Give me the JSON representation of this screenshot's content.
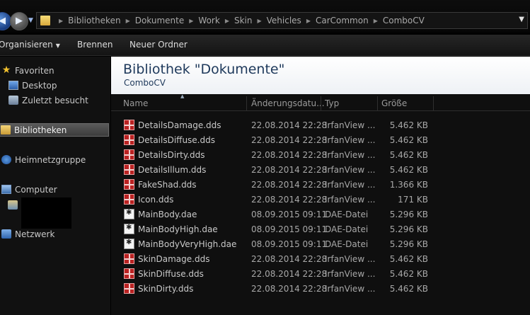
{
  "address": {
    "crumbs": [
      "Bibliotheken",
      "Dokumente",
      "Work",
      "Skin",
      "Vehicles",
      "CarCommon",
      "ComboCV"
    ]
  },
  "toolbar": {
    "organize": "Organisieren",
    "burn": "Brennen",
    "new_folder": "Neuer Ordner"
  },
  "nav": {
    "favorites": "Favoriten",
    "desktop": "Desktop",
    "recent": "Zuletzt besucht",
    "libraries": "Bibliotheken",
    "homegroup": "Heimnetzgruppe",
    "computer": "Computer",
    "network": "Netzwerk"
  },
  "header": {
    "title": "Bibliothek \"Dokumente\"",
    "subtitle": "ComboCV"
  },
  "columns": {
    "name": "Name",
    "date": "Änderungsdatu...",
    "type": "Typ",
    "size": "Größe"
  },
  "files": [
    {
      "name": "DetailsDamage.dds",
      "date": "22.08.2014 22:28",
      "type": "IrfanView ...",
      "size": "5.462 KB",
      "icon": "dds-file-icon"
    },
    {
      "name": "DetailsDiffuse.dds",
      "date": "22.08.2014 22:28",
      "type": "IrfanView ...",
      "size": "5.462 KB",
      "icon": "dds-file-icon"
    },
    {
      "name": "DetailsDirty.dds",
      "date": "22.08.2014 22:28",
      "type": "IrfanView ...",
      "size": "5.462 KB",
      "icon": "dds-file-icon"
    },
    {
      "name": "DetailsIllum.dds",
      "date": "22.08.2014 22:28",
      "type": "IrfanView ...",
      "size": "5.462 KB",
      "icon": "dds-file-icon"
    },
    {
      "name": "FakeShad.dds",
      "date": "22.08.2014 22:28",
      "type": "IrfanView ...",
      "size": "1.366 KB",
      "icon": "dds-file-icon"
    },
    {
      "name": "Icon.dds",
      "date": "22.08.2014 22:28",
      "type": "IrfanView ...",
      "size": "171 KB",
      "icon": "dds-file-icon"
    },
    {
      "name": "MainBody.dae",
      "date": "08.09.2015 09:11",
      "type": "DAE-Datei",
      "size": "5.296 KB",
      "icon": "dae-file-icon"
    },
    {
      "name": "MainBodyHigh.dae",
      "date": "08.09.2015 09:11",
      "type": "DAE-Datei",
      "size": "5.296 KB",
      "icon": "dae-file-icon"
    },
    {
      "name": "MainBodyVeryHigh.dae",
      "date": "08.09.2015 09:11",
      "type": "DAE-Datei",
      "size": "5.296 KB",
      "icon": "dae-file-icon"
    },
    {
      "name": "SkinDamage.dds",
      "date": "22.08.2014 22:28",
      "type": "IrfanView ...",
      "size": "5.462 KB",
      "icon": "dds-file-icon"
    },
    {
      "name": "SkinDiffuse.dds",
      "date": "22.08.2014 22:28",
      "type": "IrfanView ...",
      "size": "5.462 KB",
      "icon": "dds-file-icon"
    },
    {
      "name": "SkinDirty.dds",
      "date": "22.08.2014 22:28",
      "type": "IrfanView ...",
      "size": "5.462 KB",
      "icon": "dds-file-icon"
    }
  ]
}
